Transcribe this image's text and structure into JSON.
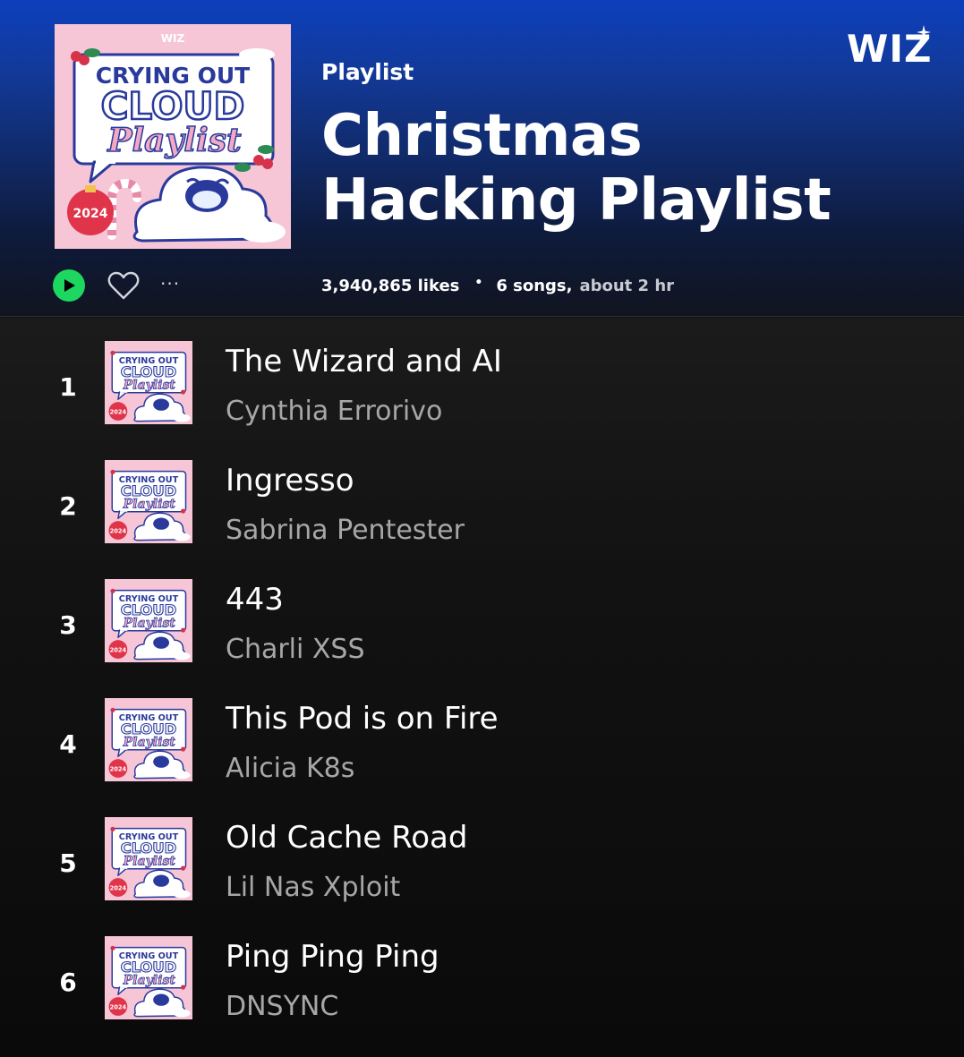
{
  "brand": {
    "logo_text": "WIZ",
    "accent": "#1ed760",
    "header_gradient_top": "#0d3fbd",
    "background": "#121212"
  },
  "cover_art": {
    "brand": "WIZ",
    "line1": "CRYING OUT",
    "line2": "CLOUD",
    "line3": "Playlist",
    "badge": "2024"
  },
  "playlist": {
    "type_label": "Playlist",
    "title_line1": "Christmas",
    "title_line2": "Hacking Playlist",
    "likes": "3,940,865 likes",
    "separator": "•",
    "songs": "6 songs,",
    "duration": "about 2 hr"
  },
  "controls": {
    "play_icon": "play-icon",
    "like_icon": "heart-icon",
    "more_label": "···"
  },
  "tracks": [
    {
      "number": "1",
      "title": "The Wizard and AI",
      "artist": "Cynthia Errorivo"
    },
    {
      "number": "2",
      "title": "Ingresso",
      "artist": "Sabrina Pentester"
    },
    {
      "number": "3",
      "title": "443",
      "artist": "Charli XSS"
    },
    {
      "number": "4",
      "title": "This Pod is on Fire",
      "artist": "Alicia K8s"
    },
    {
      "number": "5",
      "title": "Old Cache Road",
      "artist": "Lil Nas Xploit"
    },
    {
      "number": "6",
      "title": "Ping Ping Ping",
      "artist": "DNSYNC"
    }
  ]
}
